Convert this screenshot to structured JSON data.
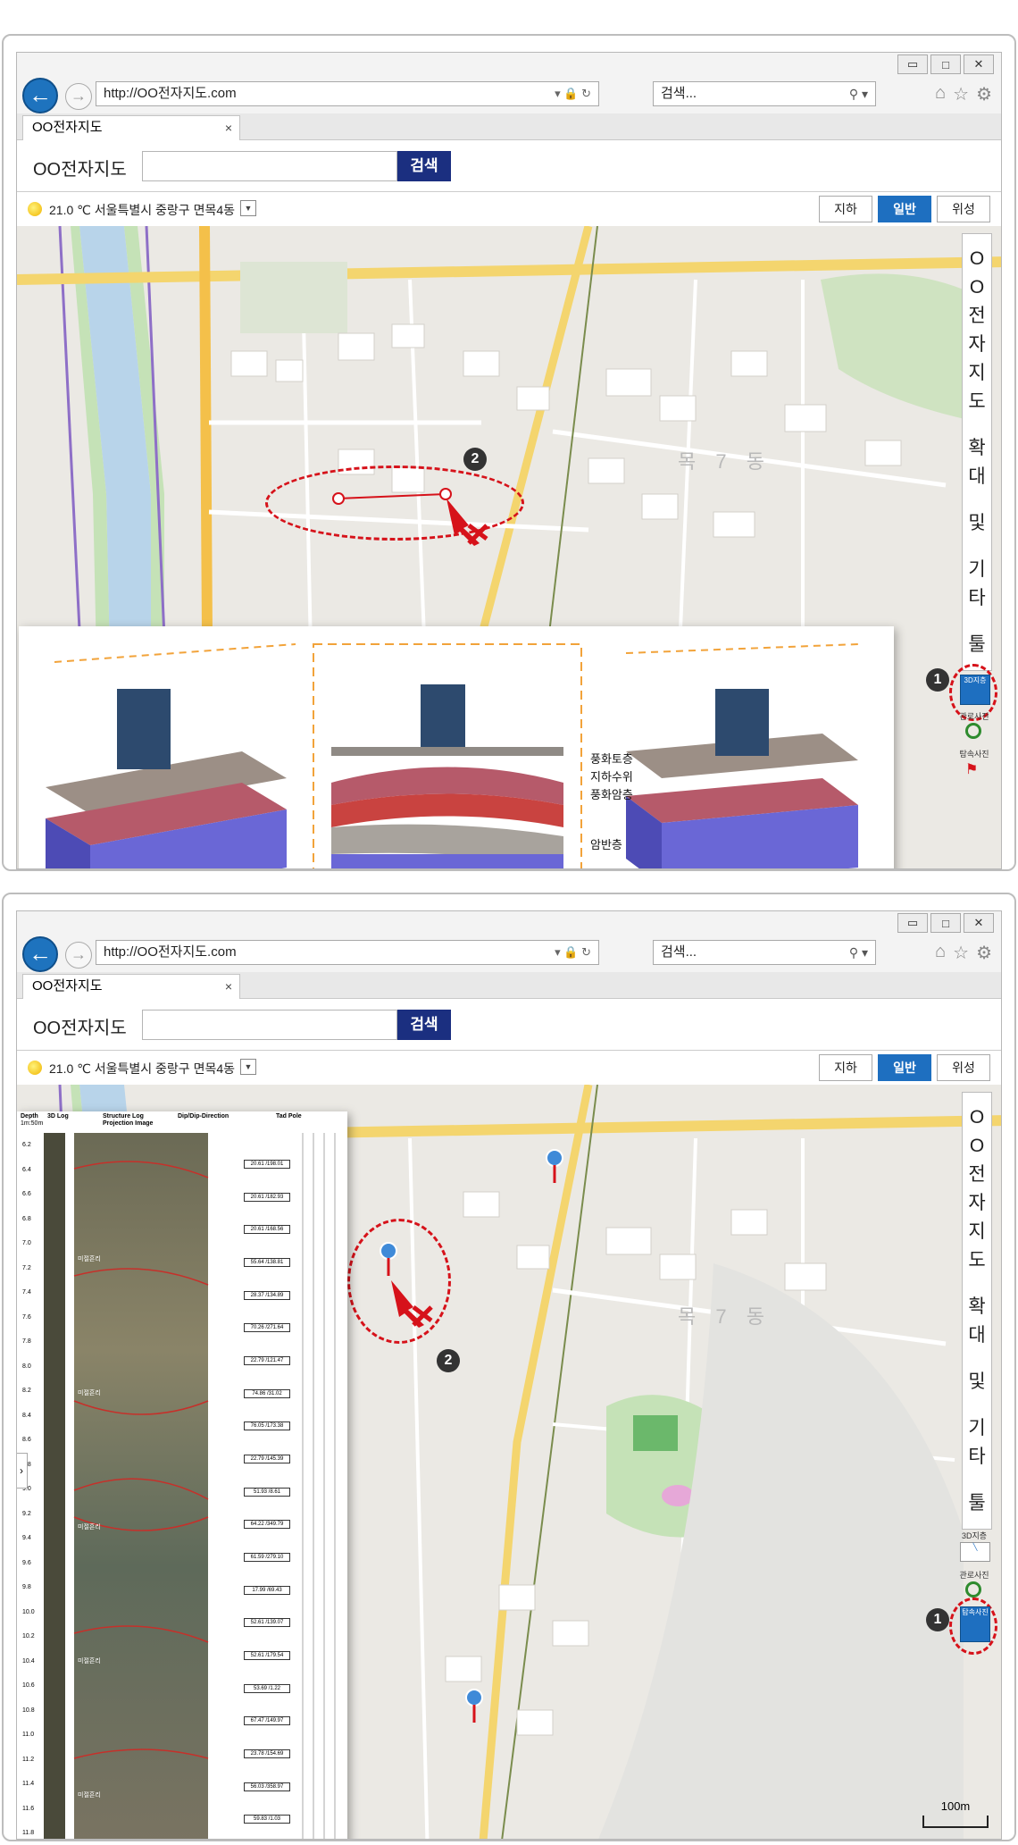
{
  "browser": {
    "url": "http://OO전자지도.com",
    "search_placeholder": "검색...",
    "tab_title": "OO전자지도",
    "tab_close": "×",
    "back_icon": "arrow-left-icon",
    "forward_icon": "arrow-right-icon"
  },
  "site": {
    "title": "OO전자지도",
    "search_button": "검색"
  },
  "infobar": {
    "weather": "21.0 ℃ 서울특별시 중랑구 면목4동"
  },
  "map_type": {
    "underground": "지하",
    "normal": "일반",
    "satellite": "위성",
    "active": "일반"
  },
  "toolbar": {
    "vertical_title": [
      "O",
      "O",
      "전",
      "자",
      "지",
      "도",
      "확",
      "대",
      "및",
      "기",
      "타",
      "툴"
    ],
    "btn_3d_layer": "3D지층",
    "btn_view_photo": "관로사진",
    "btn_borehole_photo": "탐속사진"
  },
  "map": {
    "dong_label": "목 7 동",
    "scale": "100m",
    "markers": [
      "1",
      "2"
    ]
  },
  "panel1": {
    "layers": [
      "풍화토층",
      "지하수위",
      "풍화암층",
      "암반층"
    ]
  },
  "panel2": {
    "log_headers": {
      "depth": "Depth",
      "depth_unit": "1m:50m",
      "log_3d": "3D Log",
      "structure": "Structure Log",
      "projection": "Projection Image",
      "dip": "Dip/Dip-Direction",
      "tadpole": "Tad Pole"
    },
    "depths": [
      "6.2",
      "6.4",
      "6.6",
      "6.8",
      "7.0",
      "7.2",
      "7.4",
      "7.6",
      "7.8",
      "8.0",
      "8.2",
      "8.4",
      "8.6",
      "8.8",
      "9.0",
      "9.2",
      "9.4",
      "9.6",
      "9.8",
      "10.0",
      "10.2",
      "10.4",
      "10.6",
      "10.8",
      "11.0",
      "11.2",
      "11.4",
      "11.6",
      "11.8"
    ],
    "dips": [
      "20.61 /198.01",
      "20.61 /182.93",
      "20.61 /168.56",
      "55.64 /138.81",
      "28.37 /134.89",
      "70.26 /271.64",
      "22.79 /121.47",
      "74.86 /31.02",
      "76.05 /173.38",
      "22.79 /145.39",
      "51.93 /8.61",
      "64.22 /349.79",
      "61.59 /279.10",
      "17.99 /69.43",
      "52.61 /139.07",
      "52.61 /179.54",
      "53.69 /1.22",
      "67.47 /149.97",
      "23.78 /154.69",
      "56.03 /358.97",
      "59.83 /1.03"
    ],
    "annotations": [
      "미절흔리",
      "미절흔리",
      "미절흔리",
      "미절흔리",
      "미절흔리"
    ]
  },
  "colors": {
    "accent_blue": "#1e6fc0",
    "search_navy": "#1b2f80",
    "highlight_red": "#d6121a"
  }
}
